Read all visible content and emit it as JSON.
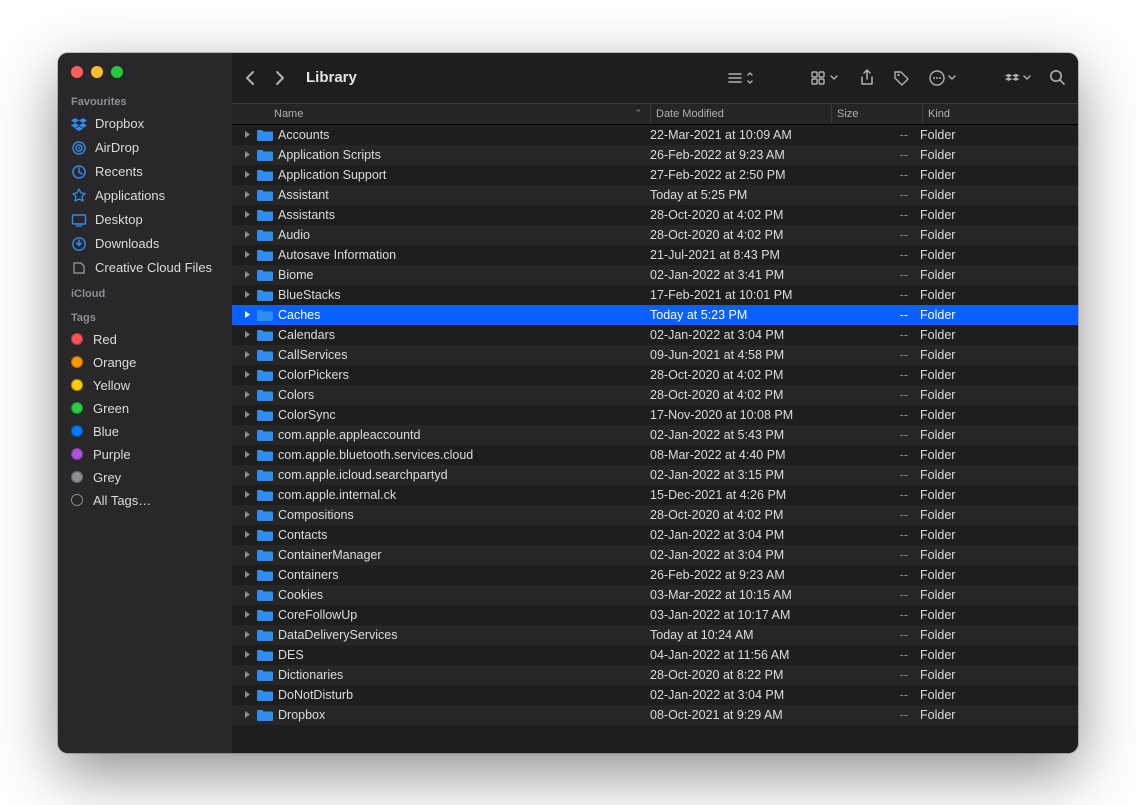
{
  "window": {
    "title": "Library"
  },
  "sidebar": {
    "sections": {
      "favourites": {
        "label": "Favourites",
        "items": [
          {
            "icon": "dropbox",
            "label": "Dropbox"
          },
          {
            "icon": "airdrop",
            "label": "AirDrop"
          },
          {
            "icon": "recents",
            "label": "Recents"
          },
          {
            "icon": "apps",
            "label": "Applications"
          },
          {
            "icon": "desktop",
            "label": "Desktop"
          },
          {
            "icon": "downloads",
            "label": "Downloads"
          },
          {
            "icon": "cc",
            "label": "Creative Cloud Files"
          }
        ]
      },
      "icloud": {
        "label": "iCloud"
      },
      "tags": {
        "label": "Tags",
        "items": [
          {
            "color": "#ff5257",
            "label": "Red"
          },
          {
            "color": "#ff9500",
            "label": "Orange"
          },
          {
            "color": "#ffcc00",
            "label": "Yellow"
          },
          {
            "color": "#28cd41",
            "label": "Green"
          },
          {
            "color": "#007aff",
            "label": "Blue"
          },
          {
            "color": "#af52de",
            "label": "Purple"
          },
          {
            "color": "#8e8e93",
            "label": "Grey"
          },
          {
            "color": "hollow",
            "label": "All Tags…"
          }
        ]
      }
    }
  },
  "columns": {
    "name": "Name",
    "date": "Date Modified",
    "size": "Size",
    "kind": "Kind"
  },
  "files": [
    {
      "name": "Accounts",
      "date": "22-Mar-2021 at 10:09 AM",
      "size": "--",
      "kind": "Folder",
      "selected": false
    },
    {
      "name": "Application Scripts",
      "date": "26-Feb-2022 at 9:23 AM",
      "size": "--",
      "kind": "Folder",
      "selected": false
    },
    {
      "name": "Application Support",
      "date": "27-Feb-2022 at 2:50 PM",
      "size": "--",
      "kind": "Folder",
      "selected": false
    },
    {
      "name": "Assistant",
      "date": "Today at 5:25 PM",
      "size": "--",
      "kind": "Folder",
      "selected": false
    },
    {
      "name": "Assistants",
      "date": "28-Oct-2020 at 4:02 PM",
      "size": "--",
      "kind": "Folder",
      "selected": false
    },
    {
      "name": "Audio",
      "date": "28-Oct-2020 at 4:02 PM",
      "size": "--",
      "kind": "Folder",
      "selected": false
    },
    {
      "name": "Autosave Information",
      "date": "21-Jul-2021 at 8:43 PM",
      "size": "--",
      "kind": "Folder",
      "selected": false
    },
    {
      "name": "Biome",
      "date": "02-Jan-2022 at 3:41 PM",
      "size": "--",
      "kind": "Folder",
      "selected": false
    },
    {
      "name": "BlueStacks",
      "date": "17-Feb-2021 at 10:01 PM",
      "size": "--",
      "kind": "Folder",
      "selected": false
    },
    {
      "name": "Caches",
      "date": "Today at 5:23 PM",
      "size": "--",
      "kind": "Folder",
      "selected": true
    },
    {
      "name": "Calendars",
      "date": "02-Jan-2022 at 3:04 PM",
      "size": "--",
      "kind": "Folder",
      "selected": false
    },
    {
      "name": "CallServices",
      "date": "09-Jun-2021 at 4:58 PM",
      "size": "--",
      "kind": "Folder",
      "selected": false
    },
    {
      "name": "ColorPickers",
      "date": "28-Oct-2020 at 4:02 PM",
      "size": "--",
      "kind": "Folder",
      "selected": false
    },
    {
      "name": "Colors",
      "date": "28-Oct-2020 at 4:02 PM",
      "size": "--",
      "kind": "Folder",
      "selected": false
    },
    {
      "name": "ColorSync",
      "date": "17-Nov-2020 at 10:08 PM",
      "size": "--",
      "kind": "Folder",
      "selected": false
    },
    {
      "name": "com.apple.appleaccountd",
      "date": "02-Jan-2022 at 5:43 PM",
      "size": "--",
      "kind": "Folder",
      "selected": false
    },
    {
      "name": "com.apple.bluetooth.services.cloud",
      "date": "08-Mar-2022 at 4:40 PM",
      "size": "--",
      "kind": "Folder",
      "selected": false
    },
    {
      "name": "com.apple.icloud.searchpartyd",
      "date": "02-Jan-2022 at 3:15 PM",
      "size": "--",
      "kind": "Folder",
      "selected": false
    },
    {
      "name": "com.apple.internal.ck",
      "date": "15-Dec-2021 at 4:26 PM",
      "size": "--",
      "kind": "Folder",
      "selected": false
    },
    {
      "name": "Compositions",
      "date": "28-Oct-2020 at 4:02 PM",
      "size": "--",
      "kind": "Folder",
      "selected": false
    },
    {
      "name": "Contacts",
      "date": "02-Jan-2022 at 3:04 PM",
      "size": "--",
      "kind": "Folder",
      "selected": false
    },
    {
      "name": "ContainerManager",
      "date": "02-Jan-2022 at 3:04 PM",
      "size": "--",
      "kind": "Folder",
      "selected": false
    },
    {
      "name": "Containers",
      "date": "26-Feb-2022 at 9:23 AM",
      "size": "--",
      "kind": "Folder",
      "selected": false
    },
    {
      "name": "Cookies",
      "date": "03-Mar-2022 at 10:15 AM",
      "size": "--",
      "kind": "Folder",
      "selected": false
    },
    {
      "name": "CoreFollowUp",
      "date": "03-Jan-2022 at 10:17 AM",
      "size": "--",
      "kind": "Folder",
      "selected": false
    },
    {
      "name": "DataDeliveryServices",
      "date": "Today at 10:24 AM",
      "size": "--",
      "kind": "Folder",
      "selected": false
    },
    {
      "name": "DES",
      "date": "04-Jan-2022 at 11:56 AM",
      "size": "--",
      "kind": "Folder",
      "selected": false
    },
    {
      "name": "Dictionaries",
      "date": "28-Oct-2020 at 8:22 PM",
      "size": "--",
      "kind": "Folder",
      "selected": false
    },
    {
      "name": "DoNotDisturb",
      "date": "02-Jan-2022 at 3:04 PM",
      "size": "--",
      "kind": "Folder",
      "selected": false
    },
    {
      "name": "Dropbox",
      "date": "08-Oct-2021 at 9:29 AM",
      "size": "--",
      "kind": "Folder",
      "selected": false
    }
  ]
}
